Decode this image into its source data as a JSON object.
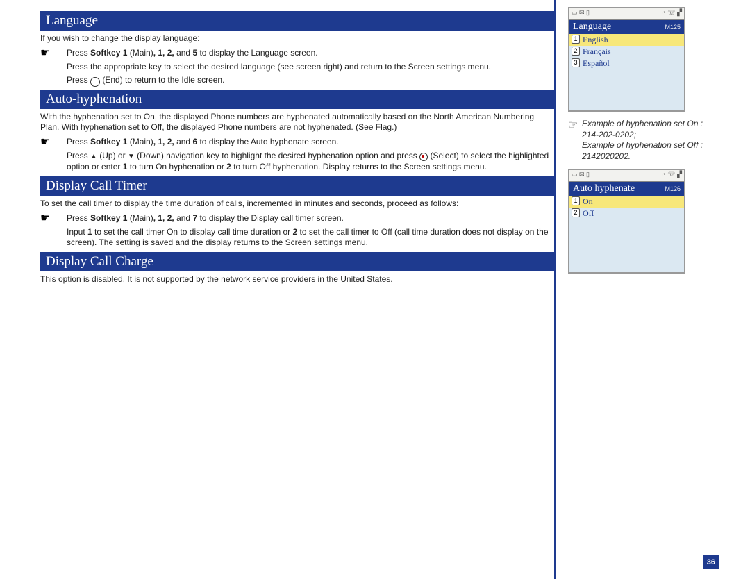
{
  "sections": {
    "language": {
      "title": "Language",
      "intro": "If you wish to change the display language:",
      "step1_pre": "Press ",
      "step1_bold1": "Softkey 1",
      "step1_mid1": " (Main)",
      "step1_bold2": ", 1, 2,",
      "step1_mid2": " and ",
      "step1_bold3": "5",
      "step1_post": " to display the Language screen.",
      "step2": "Press the appropriate key to select the desired language (see screen right) and return to the Screen settings menu.",
      "step3_pre": "Press ",
      "step3_post": " (End) to return to the Idle screen."
    },
    "auto_hyphen": {
      "title": "Auto-hyphenation",
      "intro": "With the hyphenation set to On, the displayed Phone numbers are hyphenated automatically based on the North American Numbering Plan. With hyphenation set to Off, the displayed Phone numbers are not hyphenated. (See Flag.)",
      "step1_pre": "Press ",
      "step1_bold1": "Softkey 1",
      "step1_mid1": " (Main)",
      "step1_bold2": ", 1, 2,",
      "step1_mid2": " and ",
      "step1_bold3": "6",
      "step1_post": " to display the Auto hyphenate screen.",
      "step2_a": "Press ",
      "step2_b": " (Up) or ",
      "step2_c": " (Down) navigation key to highlight the desired hyphenation option and press ",
      "step2_d": " (Select) to select the highlighted option or enter ",
      "step2_bold1": "1",
      "step2_e": " to turn On hyphenation or ",
      "step2_bold2": "2",
      "step2_f": " to turn Off hyphenation. Display returns to the Screen settings menu."
    },
    "call_timer": {
      "title": "Display Call Timer",
      "intro": "To set the call timer to display the time duration of calls, incremented in minutes and seconds, proceed as follows:",
      "step1_pre": "Press ",
      "step1_bold1": "Softkey 1",
      "step1_mid1": " (Main)",
      "step1_bold2": ", 1, 2,",
      "step1_mid2": " and ",
      "step1_bold3": "7",
      "step1_post": " to display the Display call timer screen.",
      "step2_a": "Input ",
      "step2_bold1": "1",
      "step2_b": " to set the call timer On to display call time duration or ",
      "step2_bold2": "2",
      "step2_c": " to set the call timer to Off (call time duration does not display on the screen). The setting is saved and the display returns to the Screen settings menu."
    },
    "call_charge": {
      "title": "Display Call Charge",
      "intro": "This option is disabled. It is not supported by the network service providers in the United States."
    }
  },
  "screens": {
    "language": {
      "title": "Language",
      "code": "M125",
      "items": [
        {
          "num": "1",
          "label": "English",
          "selected": true
        },
        {
          "num": "2",
          "label": "Français",
          "selected": false
        },
        {
          "num": "3",
          "label": "Español",
          "selected": false
        }
      ]
    },
    "auto_hyphen": {
      "title": "Auto hyphenate",
      "code": "M126",
      "items": [
        {
          "num": "1",
          "label": "On",
          "selected": true
        },
        {
          "num": "2",
          "label": "Off",
          "selected": false
        }
      ]
    }
  },
  "note": {
    "line1": "Example of hyphenation set On : 214-202-0202;",
    "line2": "Example of hyphenation set Off : 2142020202."
  },
  "page_number": "36"
}
